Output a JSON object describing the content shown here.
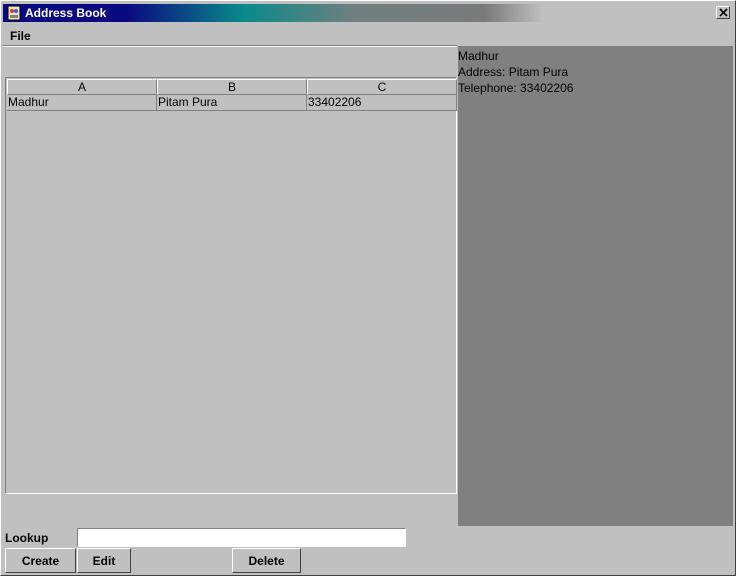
{
  "window": {
    "title": "Address Book",
    "close_symbol": "×",
    "icons": {
      "app": "address-book-icon",
      "close": "close-icon"
    }
  },
  "menu": {
    "file": "File"
  },
  "table": {
    "headers": [
      "A",
      "B",
      "C"
    ],
    "rows": [
      [
        "Madhur",
        "Pitam Pura",
        "33402206"
      ]
    ]
  },
  "details": {
    "name": "Madhur",
    "address": "Address: Pitam Pura",
    "telephone": "Telephone: 33402206"
  },
  "lookup": {
    "label": "Lookup",
    "value": ""
  },
  "buttons": {
    "create": "Create",
    "edit": "Edit",
    "delete": "Delete"
  },
  "colors": {
    "title_start": "#0a0a80",
    "title_mid": "#0a8a8a",
    "panel_bg": "#c0c0c0",
    "details_bg": "#808080"
  }
}
